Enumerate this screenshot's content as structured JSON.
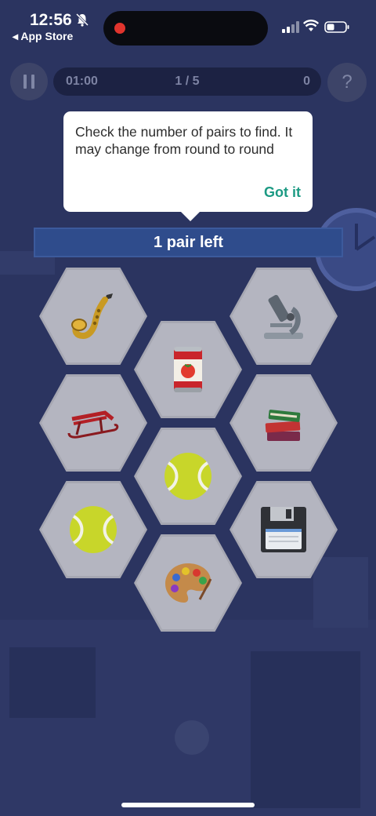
{
  "status_bar": {
    "time": "12:56",
    "back_app": "◂ App Store",
    "icons": [
      "bell-slash-icon",
      "recording-dot-icon",
      "signal-icon",
      "wifi-icon",
      "battery-icon"
    ]
  },
  "header": {
    "timer": "01:00",
    "round": "1 / 5",
    "score": "0",
    "help_label": "?",
    "icons": [
      "pause-icon",
      "help-icon"
    ]
  },
  "tooltip": {
    "text": "Check the number of pairs to find. It may change from round to round",
    "action_label": "Got it",
    "action_color": "#1c9a83"
  },
  "banner": {
    "label": "1 pair left"
  },
  "tiles": [
    {
      "item": "saxophone-icon"
    },
    {
      "item": "microscope-icon"
    },
    {
      "item": "tomato-can-icon"
    },
    {
      "item": "sled-icon"
    },
    {
      "item": "books-icon"
    },
    {
      "item": "tennis-ball-icon"
    },
    {
      "item": "tennis-ball-icon"
    },
    {
      "item": "floppy-disk-icon"
    },
    {
      "item": "palette-icon"
    }
  ],
  "colors": {
    "background": "#2b3460",
    "tile": "#b4b5c0",
    "banner": "#2f4c8c"
  }
}
